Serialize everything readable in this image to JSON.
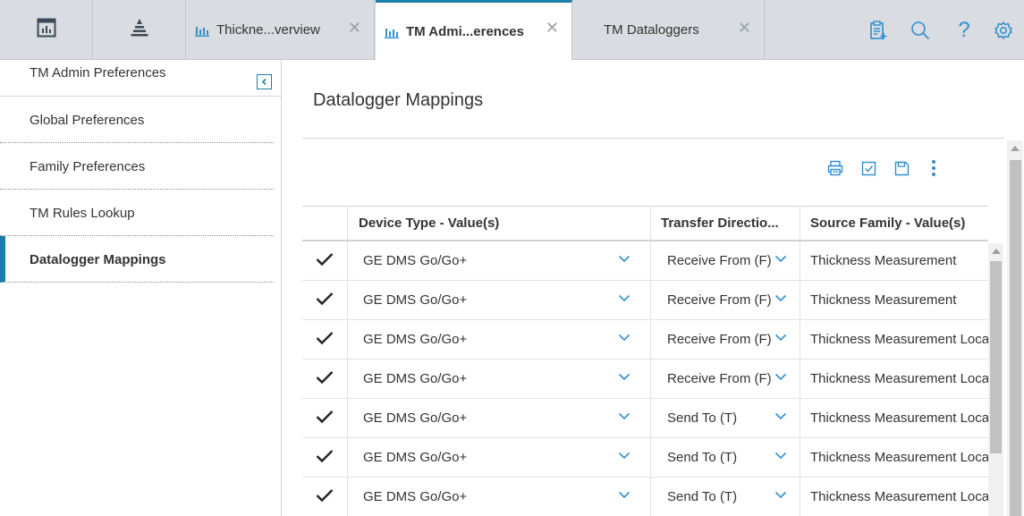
{
  "tabs": {
    "icon_tabs": [
      {
        "icon": "dashboard-icon"
      },
      {
        "icon": "pyramid-icon"
      }
    ],
    "doc_tabs": [
      {
        "label": "Thickne...verview",
        "icon": "chart-icon",
        "closable": true,
        "active": false
      },
      {
        "label": "TM Admi...erences",
        "icon": "chart-icon",
        "closable": true,
        "active": true
      },
      {
        "label": "TM Dataloggers",
        "closable": true,
        "active": false
      }
    ],
    "close_glyph": "✕",
    "tools": [
      "clipboard-add-icon",
      "search-icon",
      "help-icon",
      "settings-icon"
    ],
    "help_glyph": "?"
  },
  "sidebar": {
    "title": "TM Admin Preferences",
    "items": [
      {
        "label": "Global Preferences",
        "active": false
      },
      {
        "label": "Family Preferences",
        "active": false
      },
      {
        "label": "TM Rules Lookup",
        "active": false
      },
      {
        "label": "Datalogger Mappings",
        "active": true
      }
    ]
  },
  "main": {
    "title": "Datalogger Mappings",
    "toolbar": [
      "print-icon",
      "checkbox-icon",
      "save-icon",
      "more-options-icon"
    ]
  },
  "grid": {
    "columns": [
      "",
      "Device Type - Value(s)",
      "Transfer Directio...",
      "Source Family - Value(s)"
    ],
    "rows": [
      {
        "device": "GE DMS Go/Go+",
        "direction": "Receive From (F)",
        "source": "Thickness Measurement"
      },
      {
        "device": "GE DMS Go/Go+",
        "direction": "Receive From (F)",
        "source": "Thickness Measurement"
      },
      {
        "device": "GE DMS Go/Go+",
        "direction": "Receive From (F)",
        "source": "Thickness Measurement Loca"
      },
      {
        "device": "GE DMS Go/Go+",
        "direction": "Receive From (F)",
        "source": "Thickness Measurement Loca"
      },
      {
        "device": "GE DMS Go/Go+",
        "direction": "Send To (T)",
        "source": "Thickness Measurement Loca"
      },
      {
        "device": "GE DMS Go/Go+",
        "direction": "Send To (T)",
        "source": "Thickness Measurement Loca"
      },
      {
        "device": "GE DMS Go/Go+",
        "direction": "Send To (T)",
        "source": "Thickness Measurement Loca"
      }
    ]
  },
  "colors": {
    "accent": "#1a7fa8",
    "tabbar": "#d9dce0",
    "chevron": "#2f8fd0"
  }
}
